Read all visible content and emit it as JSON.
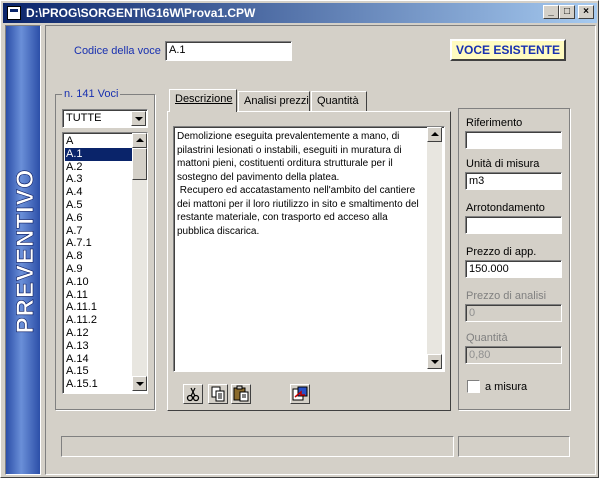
{
  "window": {
    "title": "D:\\PROG\\SORGENTI\\G16W\\Prova1.CPW",
    "min_label": "_",
    "max_label": "□",
    "close_label": "×"
  },
  "sidebar": {
    "title": "PREVENTIVO"
  },
  "header": {
    "code_label": "Codice della voce",
    "code_value": "A.1",
    "status_badge": "VOCE ESISTENTE"
  },
  "voci": {
    "count_label": "n. 141 Voci",
    "filter_value": "TUTTE",
    "items": [
      "A",
      "A.1",
      "A.2",
      "A.3",
      "A.4",
      "A.5",
      "A.6",
      "A.7",
      "A.7.1",
      "A.8",
      "A.9",
      "A.10",
      "A.11",
      "A.11.1",
      "A.11.2",
      "A.12",
      "A.13",
      "A.14",
      "A.15",
      "A.15.1"
    ],
    "selected": "A.1"
  },
  "tabs": [
    {
      "label": "Descrizione",
      "active": true
    },
    {
      "label": "Analisi prezzi",
      "active": false
    },
    {
      "label": "Quantità",
      "active": false
    }
  ],
  "description": {
    "text": "Demolizione eseguita prevalentemente a mano, di pilastrini lesionati o instabili, eseguiti in muratura di mattoni pieni, costituenti orditura strutturale per il sostegno del pavimento della platea.\n Recupero ed accatastamento nell'ambito del cantiere dei mattoni per il loro riutilizzo in sito e smaltimento del restante materiale, con trasporto ed acceso alla pubblica discarica."
  },
  "toolbar": {
    "icons": [
      "scissors-icon",
      "copy-icon",
      "paste-icon",
      "import-icon"
    ]
  },
  "details": {
    "riferimento_label": "Riferimento",
    "riferimento_value": "",
    "unita_label": "Unità di misura",
    "unita_value": "m3",
    "arrotondamento_label": "Arrotondamento",
    "arrotondamento_value": "",
    "prezzo_app_label": "Prezzo di app.",
    "prezzo_app_value": "150.000",
    "prezzo_analisi_label": "Prezzo di analisi",
    "prezzo_analisi_value": "0",
    "quantita_label": "Quantità",
    "quantita_value": "0,80",
    "a_misura_label": "a misura",
    "a_misura_checked": false
  },
  "colors": {
    "title_gradient_start": "#0a246a",
    "title_gradient_end": "#a6caf0",
    "label_blue": "#1830b0",
    "badge_bg": "#fffbc0",
    "selection": "#0a246a"
  }
}
